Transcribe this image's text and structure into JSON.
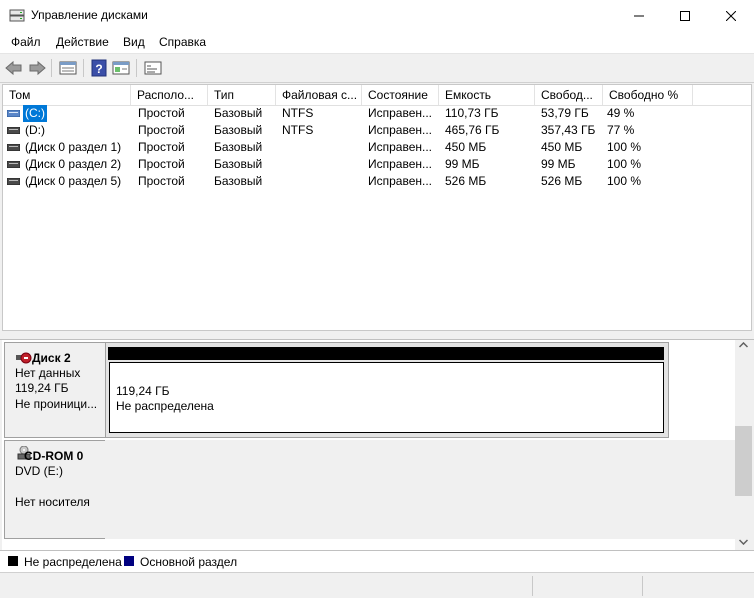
{
  "window": {
    "title": "Управление дисками",
    "minimize_icon": "minimize-icon",
    "maximize_icon": "maximize-icon",
    "close_icon": "close-icon"
  },
  "menu": [
    "Файл",
    "Действие",
    "Вид",
    "Справка"
  ],
  "toolbar": {
    "icons": [
      "back-arrow-icon",
      "forward-arrow-icon",
      "disk-list-icon",
      "help-icon",
      "volume-list-icon",
      "properties-icon"
    ]
  },
  "table": {
    "columns": [
      "Том",
      "Располо...",
      "Тип",
      "Файловая с...",
      "Состояние",
      "Емкость",
      "Свобод...",
      "Свободно %"
    ],
    "rows": [
      {
        "name": "(C:)",
        "layout": "Простой",
        "type": "Базовый",
        "fs": "NTFS",
        "status": "Исправен...",
        "capacity": "110,73 ГБ",
        "free": "53,79 ГБ",
        "free_pct": "49 %"
      },
      {
        "name": "(D:)",
        "layout": "Простой",
        "type": "Базовый",
        "fs": "NTFS",
        "status": "Исправен...",
        "capacity": "465,76 ГБ",
        "free": "357,43 ГБ",
        "free_pct": "77 %"
      },
      {
        "name": "(Диск 0 раздел 1)",
        "layout": "Простой",
        "type": "Базовый",
        "fs": "",
        "status": "Исправен...",
        "capacity": "450 МБ",
        "free": "450 МБ",
        "free_pct": "100 %"
      },
      {
        "name": "(Диск 0 раздел 2)",
        "layout": "Простой",
        "type": "Базовый",
        "fs": "",
        "status": "Исправен...",
        "capacity": "99 МБ",
        "free": "99 МБ",
        "free_pct": "100 %"
      },
      {
        "name": "(Диск 0 раздел 5)",
        "layout": "Простой",
        "type": "Базовый",
        "fs": "",
        "status": "Исправен...",
        "capacity": "526 МБ",
        "free": "526 МБ",
        "free_pct": "100 %"
      }
    ]
  },
  "disks": [
    {
      "title": "Диск 2",
      "line1": "Нет данных",
      "line2": "119,24 ГБ",
      "line3": "Не проиници...",
      "partition_size": "119,24 ГБ",
      "partition_status": "Не распределена"
    },
    {
      "title": "CD-ROM 0",
      "line1": "DVD (E:)",
      "line2": "",
      "line3": "Нет носителя"
    }
  ],
  "legend": [
    {
      "label": "Не распределена",
      "color": "#000000"
    },
    {
      "label": "Основной раздел",
      "color": "#000080"
    }
  ],
  "colors": {
    "selection": "#0078d7",
    "unallocated": "#000000",
    "primary_partition": "#000080"
  }
}
